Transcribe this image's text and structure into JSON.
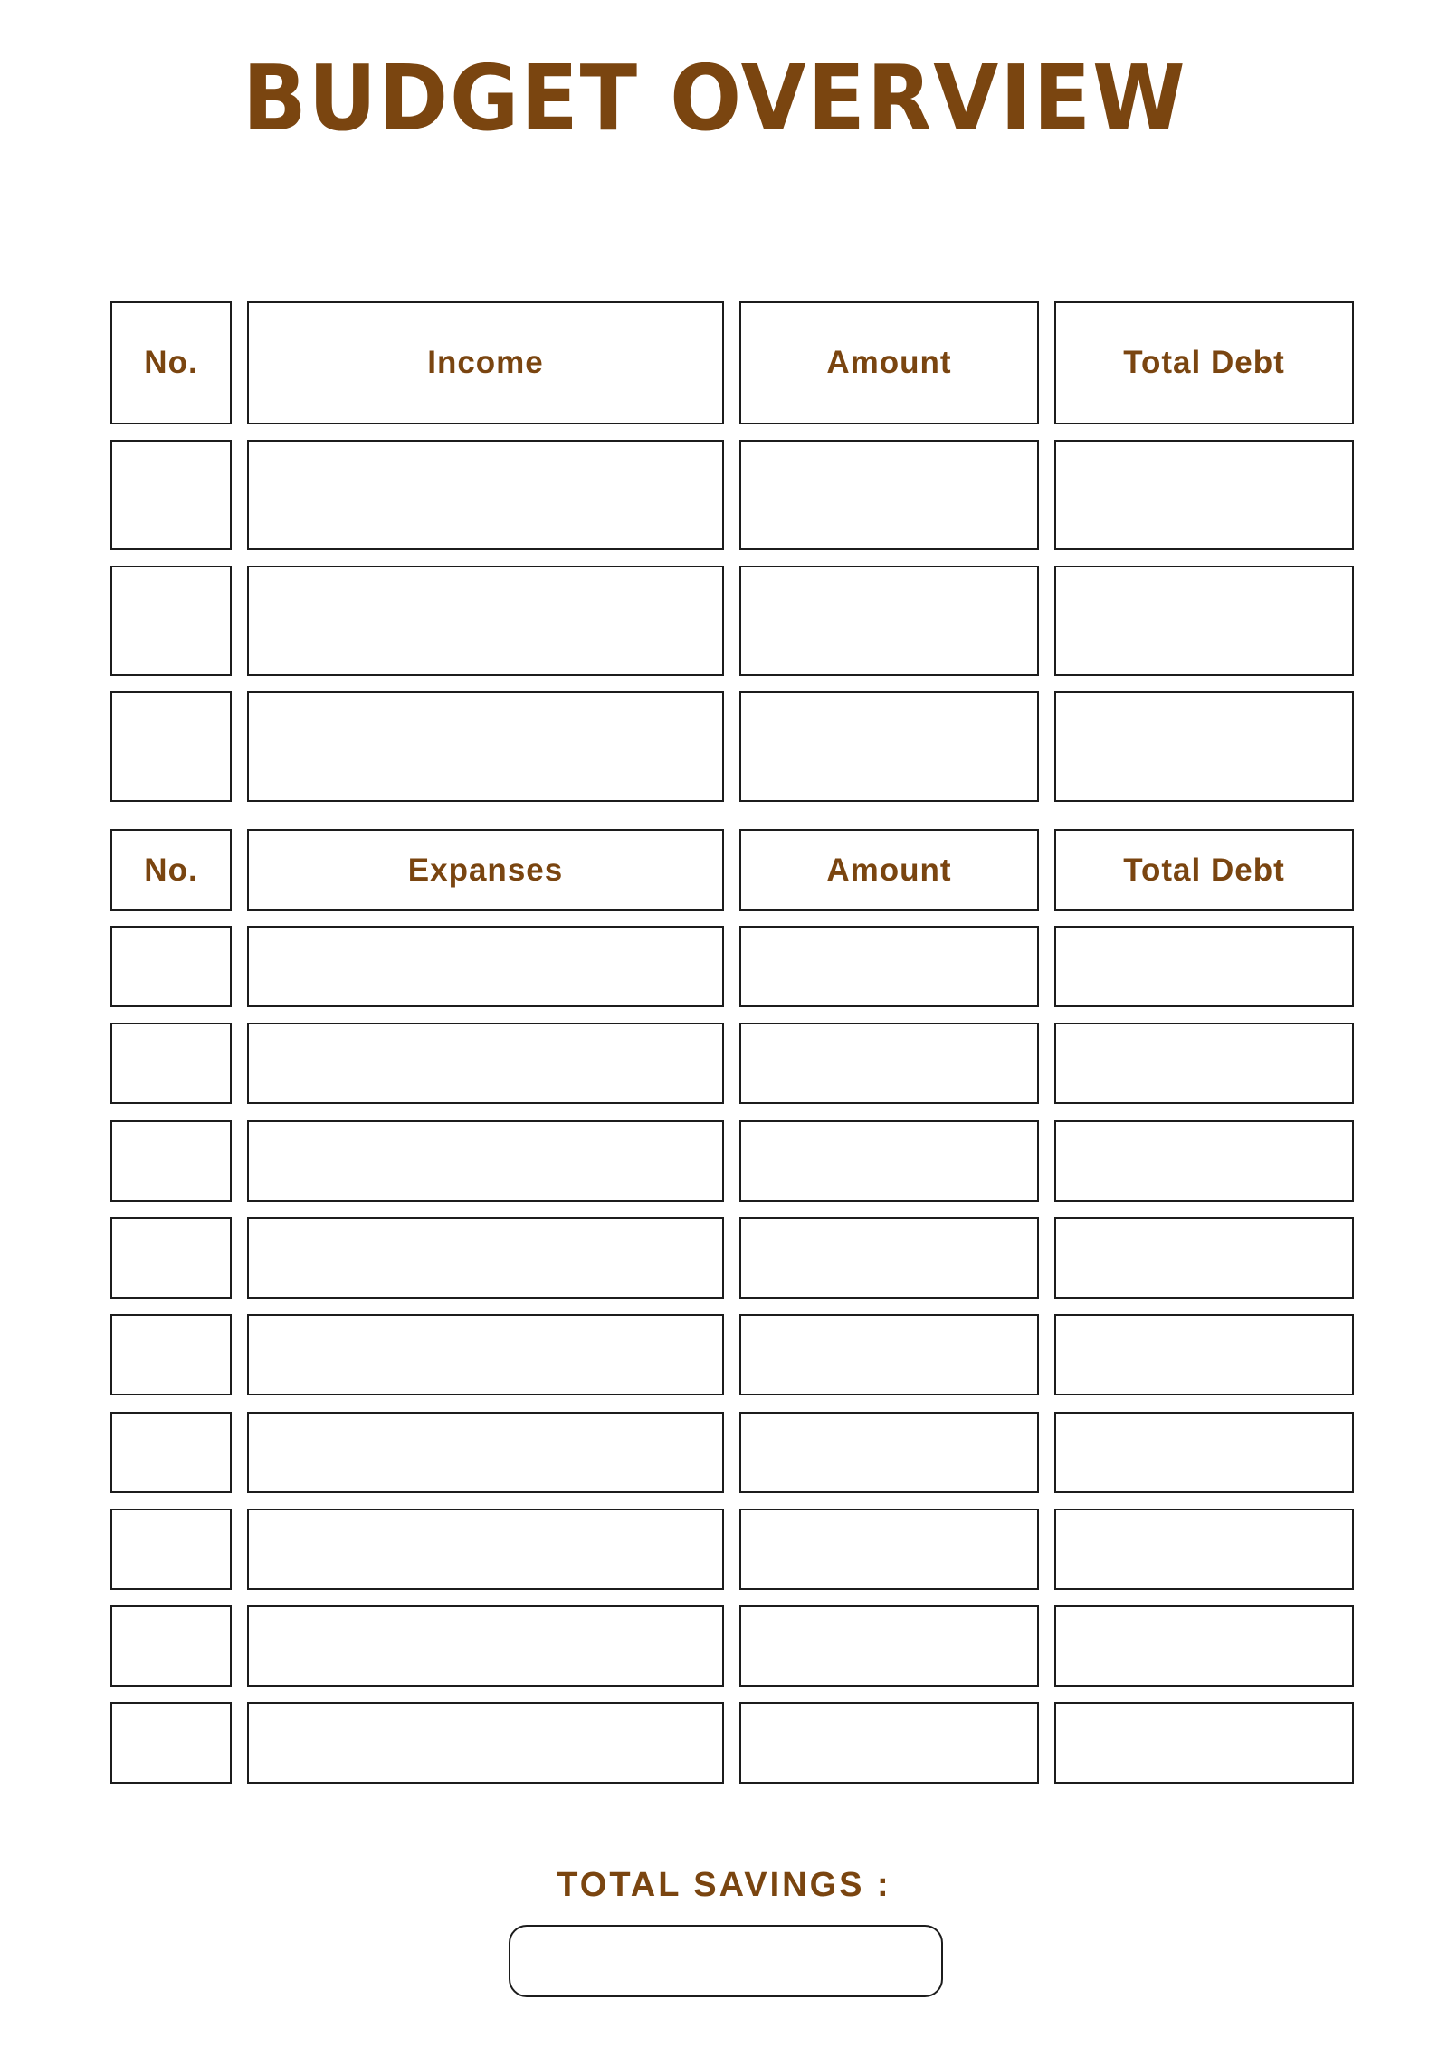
{
  "title": "BUDGET OVERVIEW",
  "income_table": {
    "headers": [
      "No.",
      "Income",
      "Amount",
      "Total Debt"
    ],
    "rows": [
      [
        "",
        "",
        "",
        ""
      ],
      [
        "",
        "",
        "",
        ""
      ],
      [
        "",
        "",
        "",
        ""
      ]
    ]
  },
  "expenses_table": {
    "headers": [
      "No.",
      "Expanses",
      "Amount",
      "Total Debt"
    ],
    "rows": [
      [
        "",
        "",
        "",
        ""
      ],
      [
        "",
        "",
        "",
        ""
      ],
      [
        "",
        "",
        "",
        ""
      ],
      [
        "",
        "",
        "",
        ""
      ],
      [
        "",
        "",
        "",
        ""
      ],
      [
        "",
        "",
        "",
        ""
      ],
      [
        "",
        "",
        "",
        ""
      ],
      [
        "",
        "",
        "",
        ""
      ],
      [
        "",
        "",
        "",
        ""
      ]
    ]
  },
  "total_savings": {
    "label": "TOTAL SAVINGS :",
    "value": ""
  },
  "colors": {
    "accent": "#7a4510",
    "border": "#1c1c1c",
    "background": "#ffffff"
  }
}
